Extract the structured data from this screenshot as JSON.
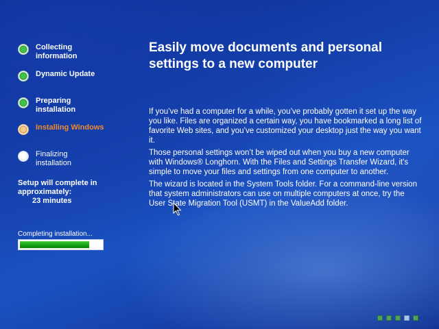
{
  "steps": [
    {
      "label": "Collecting information",
      "state": "done"
    },
    {
      "label": "Dynamic Update",
      "state": "done"
    },
    {
      "label": "Preparing installation",
      "state": "done"
    },
    {
      "label": "Installing Windows",
      "state": "current"
    },
    {
      "label": "Finalizing installation",
      "state": "pending"
    }
  ],
  "eta": {
    "line1": "Setup will complete in",
    "line2": "approximately:",
    "time": "23 minutes"
  },
  "progress": {
    "label": "Completing installation...",
    "percent": 85
  },
  "main": {
    "headline": "Easily move documents and personal settings to a new computer",
    "paragraphs": [
      "If you’ve had a computer for a while, you’ve probably gotten it set up the way you like. Files are organized a certain way, you have bookmarked a long list of favorite Web sites, and you’ve customized your desktop just the way you want it.",
      "Those personal settings won’t be wiped out when you buy a new computer with Windows® Longhorn. With the Files and Settings Transfer Wizard, it's simple to move your files and settings from one computer to another.",
      "The wizard is located in the System Tools folder. For a command-line version that system administrators can use on multiple computers at once, try the User State Migration Tool (USMT) in the ValueAdd folder."
    ]
  },
  "slide_indicator": {
    "count": 5,
    "active_index": 3
  }
}
